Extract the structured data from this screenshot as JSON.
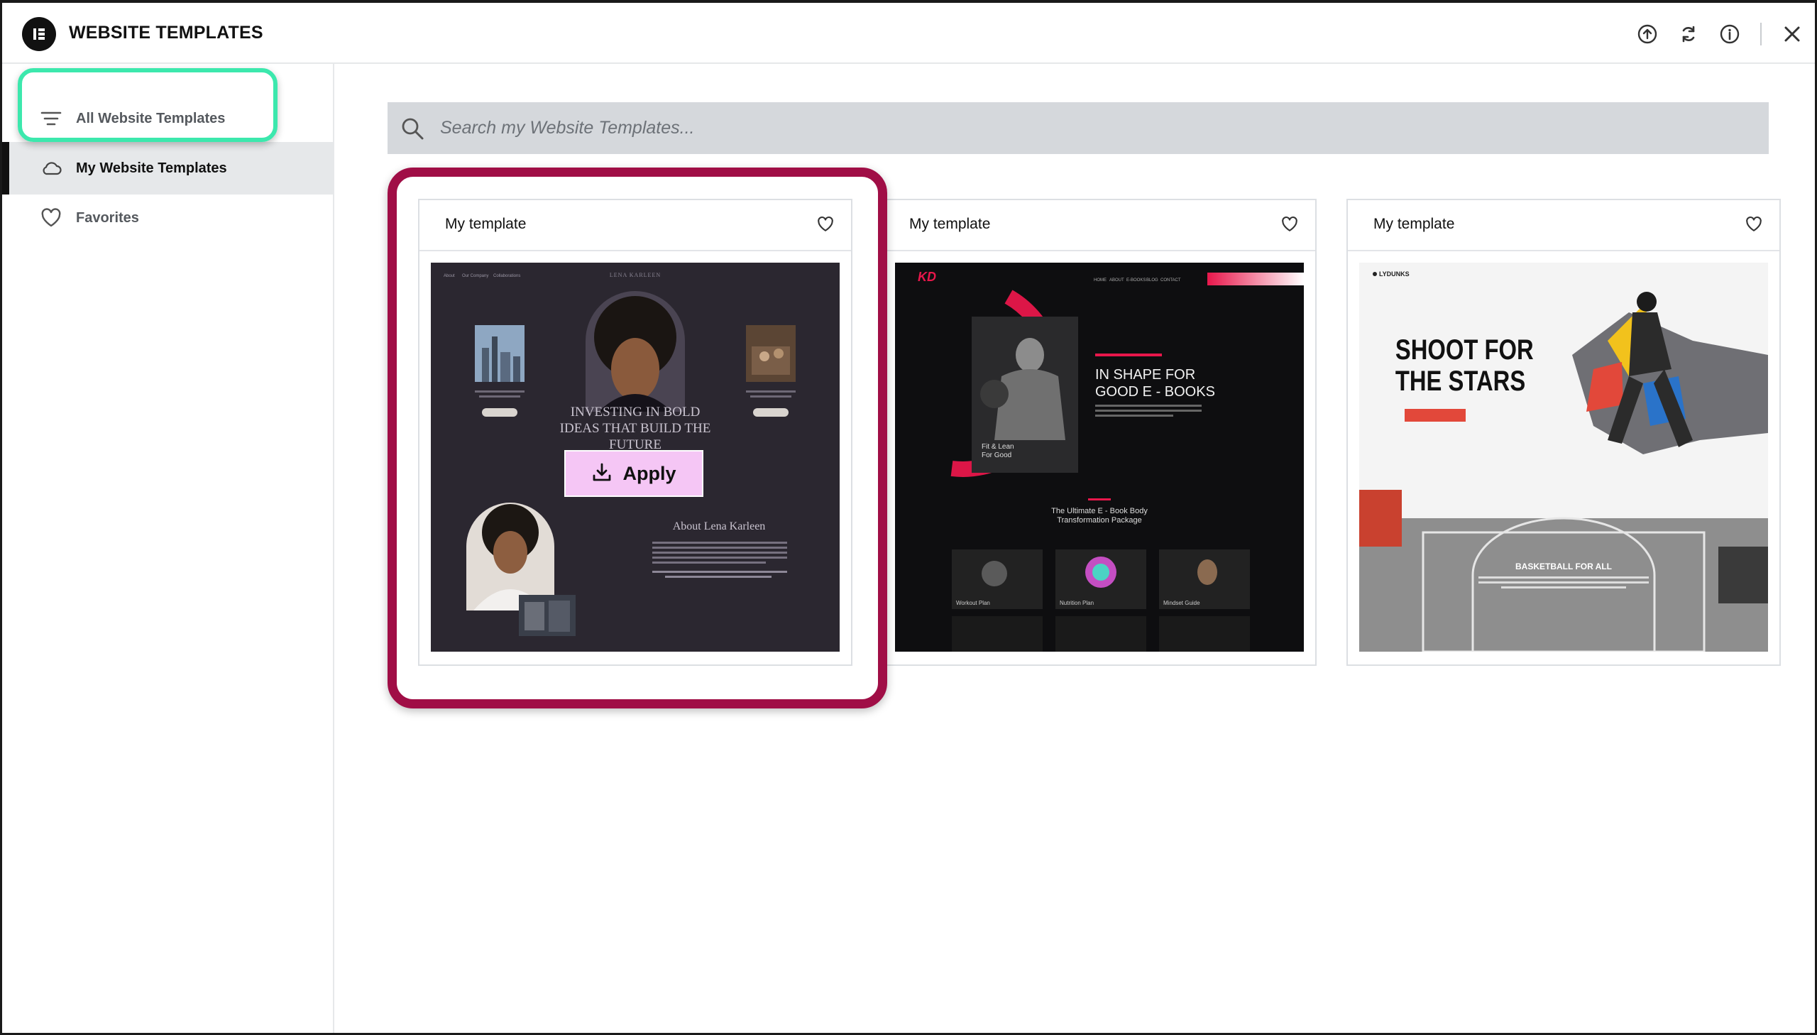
{
  "header": {
    "title": "WEBSITE TEMPLATES",
    "icons": [
      "upload-icon",
      "sync-icon",
      "info-icon",
      "close-icon"
    ]
  },
  "sidebar": {
    "items": [
      {
        "label": "All Website Templates",
        "icon": "filter-lines-icon",
        "active": false
      },
      {
        "label": "My Website Templates",
        "icon": "cloud-icon",
        "active": true
      },
      {
        "label": "Favorites",
        "icon": "heart-icon",
        "active": false
      }
    ]
  },
  "search": {
    "placeholder": "Search my Website Templates..."
  },
  "cards": [
    {
      "title": "My template",
      "thumb": {
        "nav": [
          "About",
          "Our Company",
          "Collaborations"
        ],
        "brand": "LENA KARLEEN",
        "headline": [
          "INVESTING IN BOLD",
          "IDEAS THAT BUILD THE",
          "FUTURE"
        ],
        "about_title": "About Lena Karleen"
      }
    },
    {
      "title": "My template",
      "thumb": {
        "logo": "KD",
        "nav": [
          "HOME",
          "ABOUT",
          "E-BOOKS",
          "BLOG",
          "CONTACT"
        ],
        "headline": [
          "IN SHAPE FOR",
          "GOOD E - BOOKS"
        ],
        "side_text": [
          "Fit & Lean",
          "For Good"
        ],
        "package": [
          "The Ultimate E - Book Body",
          "Transformation Package"
        ],
        "plans": [
          "Workout Plan",
          "Nutrition Plan",
          "Mindset Guide"
        ]
      }
    },
    {
      "title": "My template",
      "thumb": {
        "brand": "LYDUNKS",
        "headline": [
          "SHOOT FOR",
          "THE STARS"
        ],
        "court_title": "BASKETBALL FOR ALL"
      }
    }
  ],
  "apply": {
    "label": "Apply"
  },
  "colors": {
    "green_highlight": "#3ce8ad",
    "red_highlight": "#a00e46",
    "apply_bg": "#f5c6f5",
    "kd_accent": "#e8174b"
  }
}
